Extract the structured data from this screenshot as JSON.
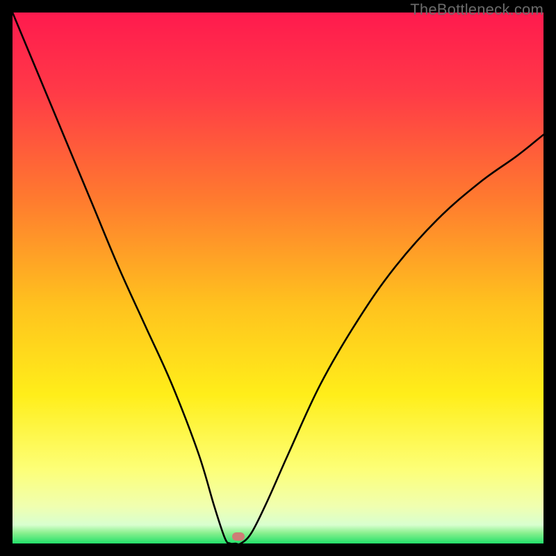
{
  "watermark": "TheBottleneck.com",
  "chart_data": {
    "type": "line",
    "title": "",
    "xlabel": "",
    "ylabel": "",
    "xlim": [
      0,
      100
    ],
    "ylim": [
      0,
      100
    ],
    "series": [
      {
        "name": "bottleneck-curve",
        "x": [
          0,
          5,
          10,
          15,
          20,
          25,
          30,
          35,
          38,
          40,
          41,
          42,
          43,
          45,
          48,
          52,
          58,
          65,
          72,
          80,
          88,
          95,
          100
        ],
        "y": [
          100,
          88,
          76,
          64,
          52,
          41,
          30,
          17,
          7,
          1,
          0,
          0,
          0,
          2,
          8,
          17,
          30,
          42,
          52,
          61,
          68,
          73,
          77
        ]
      }
    ],
    "marker": {
      "x_pct": 42.5,
      "y_pct_from_bottom": 1.3
    },
    "green_band_top_pct": 97.0,
    "gradient_stops": [
      {
        "offset": 0,
        "color": "#ff1a4e"
      },
      {
        "offset": 15,
        "color": "#ff3a47"
      },
      {
        "offset": 35,
        "color": "#ff7a2f"
      },
      {
        "offset": 55,
        "color": "#ffc21e"
      },
      {
        "offset": 72,
        "color": "#ffee1a"
      },
      {
        "offset": 86,
        "color": "#fdff77"
      },
      {
        "offset": 93,
        "color": "#f0ffb0"
      },
      {
        "offset": 96.5,
        "color": "#d8ffcf"
      },
      {
        "offset": 98,
        "color": "#8af08f"
      },
      {
        "offset": 100,
        "color": "#22e06a"
      }
    ]
  }
}
